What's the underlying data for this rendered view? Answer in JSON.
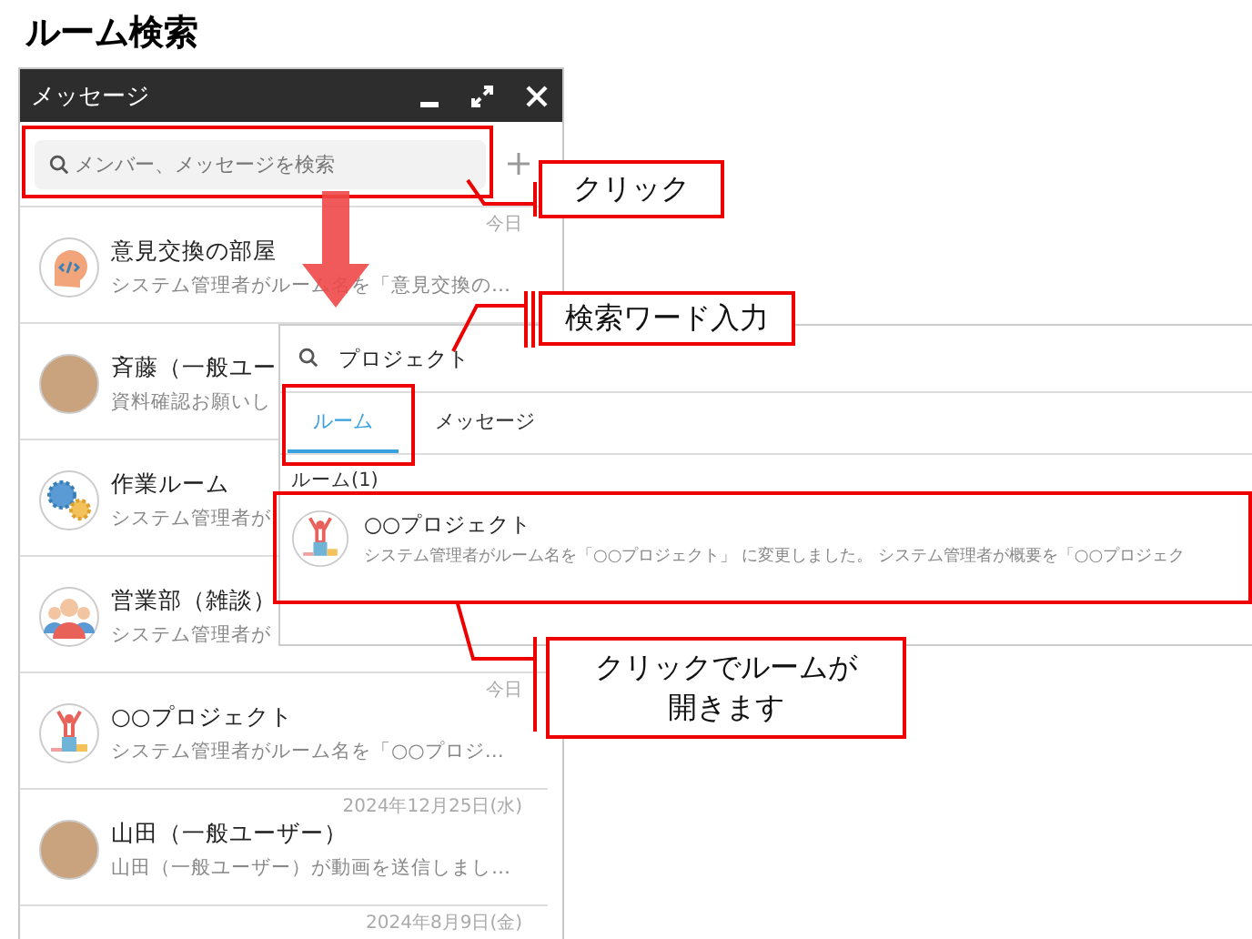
{
  "page_title": "ルーム検索",
  "messenger": {
    "title": "メッセージ",
    "search": {
      "placeholder": "メンバー、メッセージを検索"
    },
    "rooms": [
      {
        "name": "意見交換の部屋",
        "preview": "システム管理者がルーム名を「意見交換の…",
        "time": "今日",
        "kind": "head"
      },
      {
        "name": "斉藤（一般ユー",
        "preview": "資料確認お願いし",
        "kind": "photo"
      },
      {
        "name": "作業ルーム",
        "preview": "システム管理者が",
        "kind": "gears"
      },
      {
        "name": "営業部（雑談）",
        "preview": "システム管理者が",
        "kind": "group"
      },
      {
        "name": "○○プロジェクト",
        "preview": "システム管理者がルーム名を「○○プロジ…",
        "time": "今日",
        "kind": "trophy"
      },
      {
        "name": "山田（一般ユーザー）",
        "preview": "山田（一般ユーザー）が動画を送信しまし…",
        "time": "2024年12月25日(水)",
        "kind": "photo"
      },
      {
        "time": "2024年8月9日(金)",
        "kind": "empty"
      }
    ]
  },
  "search_popup": {
    "query": "プロジェクト",
    "tabs": [
      {
        "label": "ルーム",
        "selected": true
      },
      {
        "label": "メッセージ",
        "selected": false
      }
    ],
    "section": "ルーム(1)",
    "results": [
      {
        "name": "○○プロジェクト",
        "preview": "システム管理者がルーム名を「○○プロジェクト」 に変更しました。 システム管理者が概要を「○○プロジェク",
        "kind": "trophy"
      }
    ]
  },
  "callouts": [
    {
      "lines": [
        "クリック"
      ]
    },
    {
      "lines": [
        "検索ワード入力"
      ]
    },
    {
      "lines": [
        "クリックでルームが",
        "開きます"
      ]
    }
  ]
}
